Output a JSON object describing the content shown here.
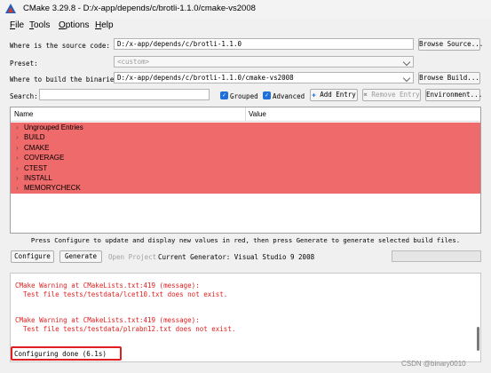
{
  "window": {
    "title": "CMake 3.29.8 - D:/x-app/depends/c/brotli-1.1.0/cmake-vs2008"
  },
  "menu": [
    {
      "accel": "F",
      "rest": "ile"
    },
    {
      "accel": "T",
      "rest": "ools"
    },
    {
      "accel": "O",
      "rest": "ptions"
    },
    {
      "accel": "H",
      "rest": "elp"
    }
  ],
  "source": {
    "label": "Where is the source code:",
    "value": "D:/x-app/depends/c/brotli-1.1.0",
    "browse": "Browse Source..."
  },
  "preset": {
    "label": "Preset:",
    "value": "<custom>"
  },
  "build": {
    "label": "Where to build the binaries:",
    "value": "D:/x-app/depends/c/brotli-1.1.0/cmake-vs2008",
    "browse": "Browse Build..."
  },
  "search": {
    "label": "Search:",
    "value": "",
    "grouped": "Grouped",
    "advanced": "Advanced",
    "add_entry": "Add Entry",
    "remove_entry": "Remove Entry",
    "environment": "Environment..."
  },
  "table": {
    "columns": [
      "Name",
      "Value"
    ],
    "rows": [
      "Ungrouped Entries",
      "BUILD",
      "CMAKE",
      "COVERAGE",
      "CTEST",
      "INSTALL",
      "MEMORYCHECK"
    ]
  },
  "info_text": "Press Configure to update and display new values in red, then press Generate to generate selected build files.",
  "actions": {
    "configure": "Configure",
    "generate": "Generate",
    "open_project": "Open Project",
    "current_generator": "Current Generator: Visual Studio 9 2008"
  },
  "output": {
    "lines": [
      "CMake Warning at CMakeLists.txt:419 (message):",
      "  Test file tests/testdata/lcet10.txt does not exist.",
      "CMake Warning at CMakeLists.txt:419 (message):",
      "  Test file tests/testdata/plrabn12.txt does not exist."
    ],
    "done": "Configuring done (6.1s)"
  },
  "watermark": "CSDN @binary0010",
  "colors": {
    "changed_row": "#ef6a6a",
    "warning_text": "#e02020",
    "check_accent": "#1e6fd9"
  }
}
